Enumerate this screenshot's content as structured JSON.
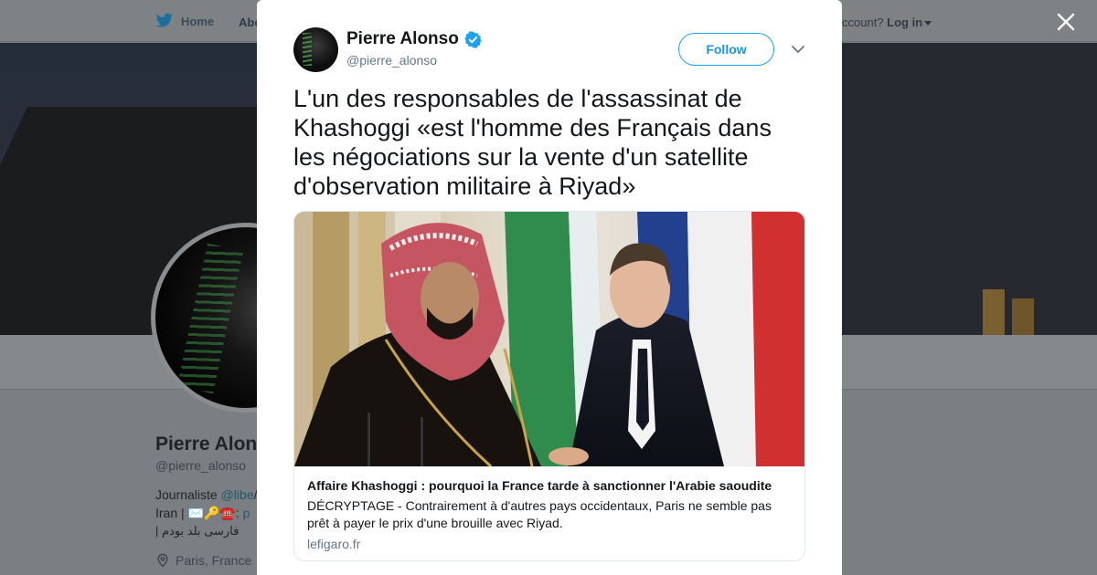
{
  "background": {
    "nav": {
      "home_label": "Home",
      "about_label": "Abo",
      "account_prefix": "ccount?",
      "login_label": "Log in"
    },
    "profile": {
      "name": "Pierre Alon",
      "handle": "@pierre_alonso",
      "bio_line1_prefix": "Journaliste ",
      "bio_line1_link": "@libe",
      "bio_line1_suffix": "/",
      "bio_line2_prefix": "Iran | ✉️🔑☎️: ",
      "bio_line2_link": "p",
      "bio_line3": "فارسی بلد بودم |",
      "location": "Paris, France"
    }
  },
  "tweet": {
    "author_name": "Pierre Alonso",
    "author_handle": "@pierre_alonso",
    "follow_label": "Follow",
    "text": "L'un des responsables de l'assassinat de Khashoggi «est l'homme des Français dans les négociations sur la vente d'un satellite d'observation militaire à Riyad»",
    "card": {
      "title": "Affaire Khashoggi : pourquoi la France tarde à sanctionner l'Arabie saoudite",
      "description": "DÉCRYPTAGE - Contrairement à d'autres pays occidentaux, Paris ne semble pas prêt à payer le prix d'une brouille avec Riyad.",
      "domain": "lefigaro.fr"
    }
  },
  "colors": {
    "accent": "#1da1f2",
    "follow_text": "#1b95e0",
    "secondary_text": "#657786"
  },
  "icons": [
    "twitter-bird-icon",
    "caret-down-icon",
    "close-icon",
    "verified-badge-icon",
    "chevron-down-icon",
    "location-pin-icon"
  ]
}
